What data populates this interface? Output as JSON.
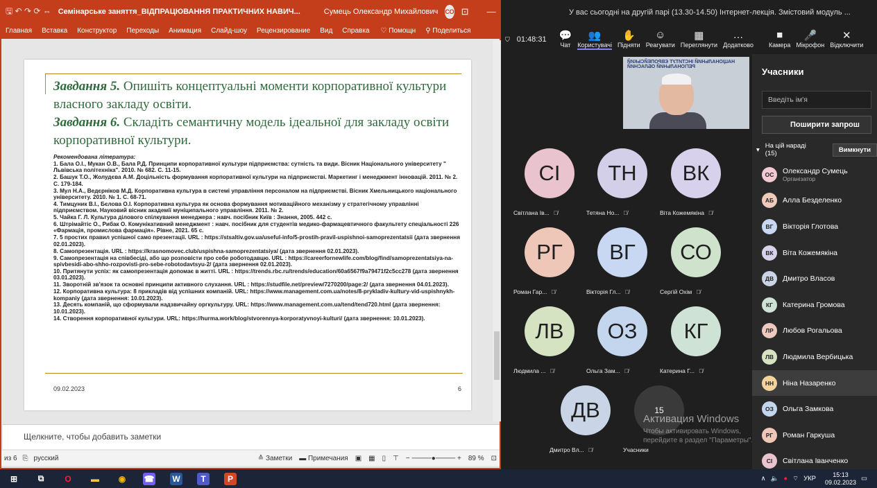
{
  "ppt": {
    "quick_access": "🖫 ↶ ↷ ⟳ ⇔",
    "title": "Семінарське заняття_ВІДПРАЦЮВАННЯ ПРАКТИЧНИХ НАВИЧ...",
    "user": "Сумець Олександр Михайлович",
    "user_initials": "СО",
    "tabs": [
      "Главная",
      "Вставка",
      "Конструктор",
      "Переходы",
      "Анимация",
      "Слайд-шоу",
      "Рецензирование",
      "Вид",
      "Справка"
    ],
    "tell_me": "Помощн",
    "share": "Поделиться",
    "slide": {
      "task5_head": "Завдання 5.",
      "task5_text": " Опишіть концептуальні моменти корпоративної культури власного закладу освіти.",
      "task6_head": "Завдання 6.",
      "task6_text": "  Складіть семантичну модель ідеальної для закладу освіти корпоративної культури.",
      "lit_header": "Рекомендована література:",
      "references": [
        "1. Бала О.І., Мукан О.В., Бала Р.Д. Принципи корпоративної культури підприємства: сутність та види. Вісник Національного університету \" Львівська політехніка\". 2010. № 682. С. 11-15.",
        "2. Башук Т.О., Жолудєва А.М. Доцільність формування корпоративної культури на підприємстві. Маркетинг і менеджмент інновацій. 2011. № 2. С. 179-184.",
        "3. Мул Н.А., Ведєрніков М.Д. Корпоративна культура в системі управління персоналом на підприємстві. Вісник Хмельницького національного університету. 2010. № 1. С. 68-71.",
        "4. Тимцуник В.І., Бєлова О.І. Корпоративна культура як основа формування мотиваційного механізму у стратегічному управлінні підприємством. Науковий вісник академії муніципального управління. 2011. № 2.",
        "5. Чайка Г. Л. Культура ділового спілкування менеджера : навч. посібник Київ : Знання, 2005. 442 с.",
        "6. Штрімайтіс О., Рибак О. Комунікативний менеджмент : навч. посібник для студентів медико-фармацевтичного факультету спеціальності 226 «Фармація, промислова фармація». Рівне, 2021. 65 с.",
        "7. 5 простих правил успішної само презентації. URL : https://stsaltiv.gov.ua/useful-info/5-prostih-pravil-uspishnoi-samoprezentatsii (дата звернення 02.01.2023).",
        "8. Самопрезентація. URL : https://krasnomovec.club/uspishna-samoprezentatsiya/ (дата звернення 02.01.2023).",
        "9. Самопрезентація на співбесіді, або що розповісти про себе роботодавцю. URL : https://careerfornewlife.com/blog/find/samoprezentatsiya-na-spivbesidi-abo-shho-rozpovisti-pro-sebe-robotodavtsyu-2/ (дата звернення 02.01.2023).",
        "10. Притянути успіх: як самопрезентація допомає в житті. URL : https://trends.rbc.ru/trends/education/60a6567f9a79471f2c5cc278 (дата звернення 03.01.2023).",
        "11. Зворотній зв'язок та основні принципи активного слухання. URL : https://studfile.net/preview/7270200/page:2/ (дата звернення 04.01.2023).",
        "12. Корпоративна культура: 8 прикладів від успішних компаній. URL: https://www.management.com.ua/notes/8-prykladiv-kultury-vid-uspishnykh-kompaniy (дата звернення: 10.01.2023).",
        "13. Десять компаній, що сформували надзвичайну оргкультуру. URL: https://www.management.com.ua/tend/tend720.html (дата звернення: 10.01.2023).",
        "14. Створення корпоративної культури. URL: https://hurma.work/blog/stvorennya-korporatyvnoyi-kulturi/ (дата звернення: 10.01.2023)."
      ],
      "date": "09.02.2023",
      "number": "6"
    },
    "notes_placeholder": "Щелкните, чтобы добавить заметки",
    "status": {
      "slide_of": "из 6",
      "language": "русский",
      "notes": "Заметки",
      "comments": "Примечания",
      "zoom": "89 %"
    }
  },
  "teams": {
    "banner": "У вас сьогодні на другій парі (13.30-14.50) Інтернет-лекція. Змістовий модуль ...",
    "timer": "01:48:31",
    "tools": [
      {
        "icon": "chat-icon",
        "glyph": "💬",
        "label": "Чат"
      },
      {
        "icon": "people-icon",
        "glyph": "👥",
        "label": "Користувачі"
      },
      {
        "icon": "raise-hand-icon",
        "glyph": "✋",
        "label": "Підняти"
      },
      {
        "icon": "react-icon",
        "glyph": "☺",
        "label": "Реагувати"
      },
      {
        "icon": "view-icon",
        "glyph": "▦",
        "label": "Переглянути"
      },
      {
        "icon": "more-icon",
        "glyph": "…",
        "label": "Додатково"
      },
      {
        "icon": "camera-icon",
        "glyph": "■",
        "label": "Камера"
      },
      {
        "icon": "mic-icon",
        "glyph": "🎤",
        "label": "Мікрофон"
      },
      {
        "icon": "leave-icon",
        "glyph": "✕",
        "label": "Відключити"
      }
    ],
    "speaker_banner": "НАЦІОНАЛЬНИЙ ІНСТИТУТ ЄВРОПЕЙСЬКИЙ РЕГІОНАЛЬНИЙ ОБЛАСНИЙ",
    "tiles": [
      {
        "initials": "СІ",
        "name": "Світлана Ів...",
        "color": "#e9c3ce"
      },
      {
        "initials": "ТН",
        "name": "Тетяна Но...",
        "color": "#d3cfe8"
      },
      {
        "initials": "ВК",
        "name": "Віта Кожемякіна",
        "color": "#d8d1eb"
      },
      {
        "initials": "РГ",
        "name": "Роман Гар...",
        "color": "#efc7b8"
      },
      {
        "initials": "ВГ",
        "name": "Вікторія Гл...",
        "color": "#c8d7f2"
      },
      {
        "initials": "СО",
        "name": "Сергій Охім",
        "color": "#cfe3cc"
      },
      {
        "initials": "ЛВ",
        "name": "Людмила ...",
        "color": "#d6e3c3"
      },
      {
        "initials": "ОЗ",
        "name": "Ольга Зам...",
        "color": "#c3d6ee"
      },
      {
        "initials": "КГ",
        "name": "Катерина Г...",
        "color": "#cfe2d6"
      },
      {
        "initials": "ДВ",
        "name": "Дмитро Вл...",
        "color": "#c9d5e7"
      },
      {
        "initials": "15",
        "name": "Учасники",
        "color": "#3a3a3a"
      }
    ],
    "watermark_title": "Активация Windows",
    "watermark_text": "Чтобы активировать Windows, перейдите в раздел \"Параметры\".",
    "panel": {
      "title": "Учасники",
      "search_placeholder": "Введіть ім'я",
      "share_label": "Поширити запрош",
      "section": "На цій нараді (15)",
      "mute_all": "Вимкнути",
      "people": [
        {
          "initials": "ОС",
          "name": "Олександр Сумець",
          "role": "Організатор",
          "color": "#f2c8d3"
        },
        {
          "initials": "АБ",
          "name": "Алла Безделенко",
          "role": "",
          "color": "#efc9b9"
        },
        {
          "initials": "ВГ",
          "name": "Вікторія Глотова",
          "role": "",
          "color": "#c8d7f2"
        },
        {
          "initials": "ВК",
          "name": "Віта Кожемякіна",
          "role": "",
          "color": "#d8d1eb"
        },
        {
          "initials": "ДВ",
          "name": "Дмитро Власов",
          "role": "",
          "color": "#c9d5e7"
        },
        {
          "initials": "КГ",
          "name": "Катерина Громова",
          "role": "",
          "color": "#cfe2d6"
        },
        {
          "initials": "ЛР",
          "name": "Любов Рогальова",
          "role": "",
          "color": "#efc9c0"
        },
        {
          "initials": "ЛВ",
          "name": "Людмила Вербицька",
          "role": "",
          "color": "#d6e3c3"
        },
        {
          "initials": "НН",
          "name": "Ніна Назаренко",
          "role": "",
          "color": "#f4d49a"
        },
        {
          "initials": "ОЗ",
          "name": "Ольга Замкова",
          "role": "",
          "color": "#c3d6ee"
        },
        {
          "initials": "РГ",
          "name": "Роман Гаркуша",
          "role": "",
          "color": "#efc7b8"
        },
        {
          "initials": "СІ",
          "name": "Світлана Іванченко",
          "role": "",
          "color": "#e9c3ce"
        }
      ]
    }
  },
  "taskbar": {
    "apps": [
      {
        "icon": "windows-start-icon",
        "glyph": "⊞",
        "color": "#ffffff",
        "bg": "transparent"
      },
      {
        "icon": "task-view-icon",
        "glyph": "⧉",
        "color": "#ffffff",
        "bg": "transparent"
      },
      {
        "icon": "opera-icon",
        "glyph": "O",
        "color": "#ff1b2d",
        "bg": "transparent"
      },
      {
        "icon": "file-explorer-icon",
        "glyph": "▬",
        "color": "#f4c542",
        "bg": "transparent"
      },
      {
        "icon": "chrome-icon",
        "glyph": "◉",
        "color": "#f4b400",
        "bg": "transparent"
      },
      {
        "icon": "viber-icon",
        "glyph": "☎",
        "color": "#ffffff",
        "bg": "#7360f2"
      },
      {
        "icon": "word-icon",
        "glyph": "W",
        "color": "#ffffff",
        "bg": "#2b579a"
      },
      {
        "icon": "teams-icon",
        "glyph": "T",
        "color": "#ffffff",
        "bg": "#5059c9"
      },
      {
        "icon": "powerpoint-icon",
        "glyph": "P",
        "color": "#ffffff",
        "bg": "#d24726"
      }
    ],
    "lang": "УКР",
    "time": "15:13",
    "date": "09.02.2023"
  }
}
